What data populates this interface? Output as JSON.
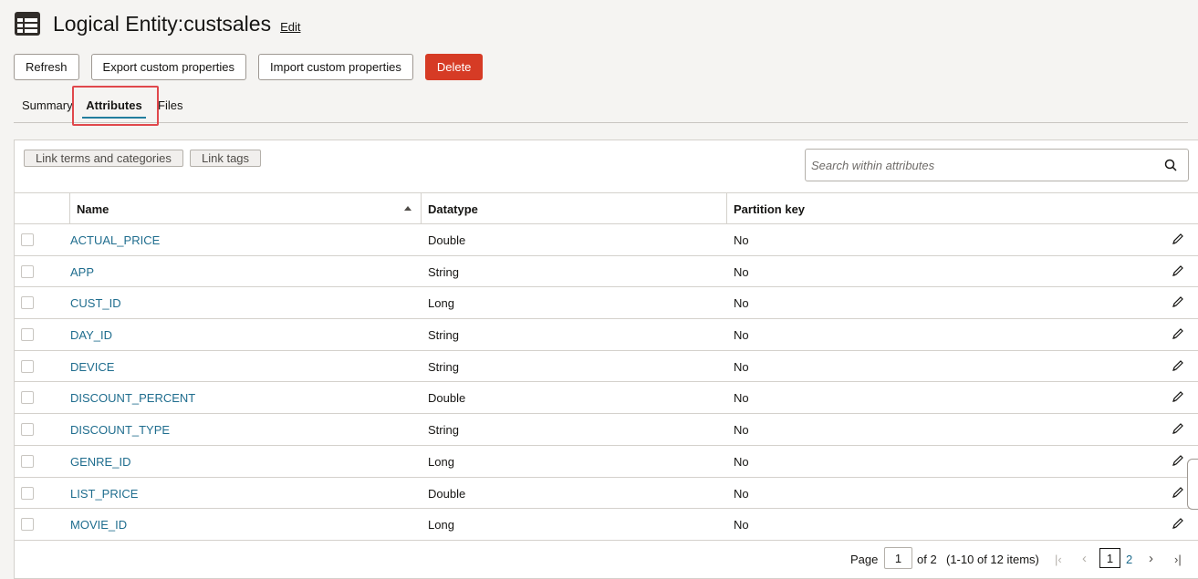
{
  "header": {
    "title": "Logical Entity:custsales",
    "edit_label": "Edit",
    "icon": "table-icon"
  },
  "toolbar": {
    "refresh": "Refresh",
    "export": "Export custom properties",
    "import": "Import custom properties",
    "delete": "Delete"
  },
  "tabs": {
    "summary": "Summary",
    "attributes": "Attributes",
    "files": "Files",
    "active": "Attributes"
  },
  "actions": {
    "link_terms": "Link terms and categories",
    "link_tags": "Link tags"
  },
  "search": {
    "placeholder": "Search within attributes",
    "value": "",
    "icon": "search-icon"
  },
  "table": {
    "columns": [
      "Name",
      "Datatype",
      "Partition key"
    ],
    "sort": "Name ascending",
    "rows": [
      [
        "ACTUAL_PRICE",
        "Double",
        "No"
      ],
      [
        "APP",
        "String",
        "No"
      ],
      [
        "CUST_ID",
        "Long",
        "No"
      ],
      [
        "DAY_ID",
        "String",
        "No"
      ],
      [
        "DEVICE",
        "String",
        "No"
      ],
      [
        "DISCOUNT_PERCENT",
        "Double",
        "No"
      ],
      [
        "DISCOUNT_TYPE",
        "String",
        "No"
      ],
      [
        "GENRE_ID",
        "Long",
        "No"
      ],
      [
        "LIST_PRICE",
        "Double",
        "No"
      ],
      [
        "MOVIE_ID",
        "Long",
        "No"
      ]
    ]
  },
  "pagination": {
    "page_label": "Page",
    "current_page": "1",
    "of_label": "of 2",
    "items_label": "(1-10 of 12 items)",
    "pages": [
      "1",
      "2"
    ]
  },
  "colors": {
    "accent": "#227e9e",
    "link": "#1f6d8e",
    "danger": "#d63b25",
    "highlight": "#e0484c"
  }
}
